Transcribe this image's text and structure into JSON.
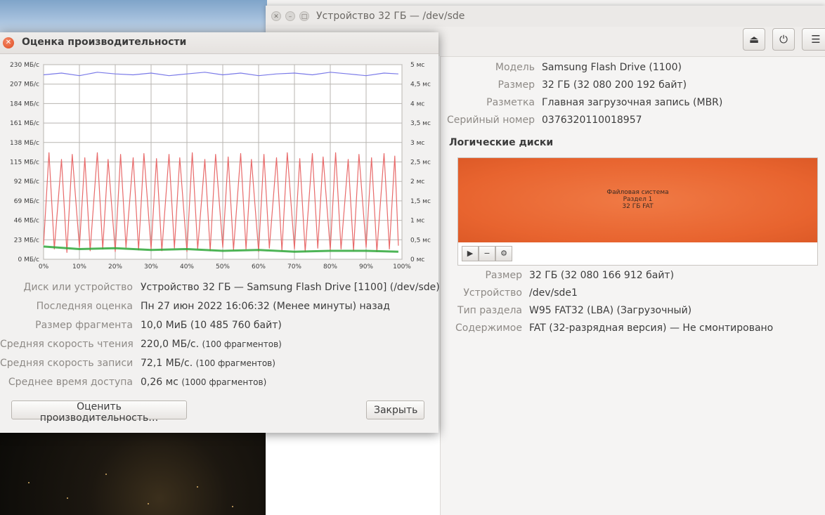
{
  "desktop": {
    "top_text": ""
  },
  "disks_window": {
    "title": "Устройство 32 ГБ — /dev/sde",
    "toolbar": {
      "eject_icon": "eject-icon",
      "power_icon": "power-icon",
      "menu_icon": "menu-icon"
    },
    "drive": {
      "model_label": "Модель",
      "model_value": "Samsung Flash Drive (1100)",
      "size_label": "Размер",
      "size_value": "32 ГБ (32 080 200 192 байт)",
      "partitioning_label": "Разметка",
      "partitioning_value": "Главная загрузочная запись (MBR)",
      "serial_label": "Серийный номер",
      "serial_value": "0376320110018957"
    },
    "volumes_heading": "Логические диски",
    "partition": {
      "line1": "Файловая система",
      "line2": "Раздел 1",
      "line3": "32 ГБ FAT"
    },
    "volume": {
      "size_label": "Размер",
      "size_value": "32 ГБ (32 080 166 912 байт)",
      "device_label": "Устройство",
      "device_value": "/dev/sde1",
      "type_label": "Тип раздела",
      "type_value": "W95 FAT32 (LBA) (Загрузочный)",
      "contents_label": "Содержимое",
      "contents_value": "FAT (32-разрядная версия) — Не смонтировано"
    },
    "colors": {
      "partition": "#e8642f"
    }
  },
  "benchmark_dialog": {
    "title": "Оценка производительности",
    "stats": {
      "device_label": "Диск или устройство",
      "device_value": "Устройство 32 ГБ — Samsung Flash Drive [1100] (/dev/sde)",
      "last_label": "Последняя оценка",
      "last_value": "Пн 27 июн 2022 16:06:32 (Менее минуты) назад",
      "sample_label": "Размер фрагмента",
      "sample_value": "10,0 МиБ (10 485 760 байт)",
      "read_label": "Средняя скорость чтения",
      "read_value": "220,0 МБ/с.",
      "read_note": "(100 фрагментов)",
      "write_label": "Средняя скорость записи",
      "write_value": "72,1 МБ/с.",
      "write_note": "(100 фрагментов)",
      "access_label": "Среднее время доступа",
      "access_value": "0,26 мс",
      "access_note": "(1000 фрагментов)"
    },
    "buttons": {
      "benchmark": "Оценить производительность…",
      "close": "Закрыть"
    }
  },
  "chart_data": {
    "type": "line",
    "title": "",
    "xlabel": "",
    "ylabel": "",
    "x_ticks": [
      "0%",
      "10%",
      "20%",
      "30%",
      "40%",
      "50%",
      "60%",
      "70%",
      "80%",
      "90%",
      "100%"
    ],
    "y_left_ticks": [
      "0 МБ/с",
      "23 МБ/с",
      "46 МБ/с",
      "69 МБ/с",
      "92 МБ/с",
      "115 МБ/с",
      "138 МБ/с",
      "161 МБ/с",
      "184 МБ/с",
      "207 МБ/с",
      "230 МБ/с"
    ],
    "y_right_ticks": [
      "0 мс",
      "0,5 мс",
      "1 мс",
      "1,5 мс",
      "2 мс",
      "2,5 мс",
      "3 мс",
      "3,5 мс",
      "4 мс",
      "4,5 мс",
      "5 мс"
    ],
    "xlim": [
      0,
      100
    ],
    "ylim_left": [
      0,
      230
    ],
    "ylim_right": [
      0,
      5
    ],
    "grid": true,
    "series": [
      {
        "axis": "left",
        "color": "#7a7ae8",
        "x": [
          0,
          5,
          10,
          15,
          20,
          25,
          30,
          35,
          40,
          45,
          50,
          55,
          60,
          65,
          70,
          75,
          80,
          85,
          90,
          95,
          99
        ],
        "values": [
          218,
          220,
          217,
          221,
          219,
          218,
          220,
          217,
          219,
          221,
          218,
          220,
          217,
          219,
          220,
          218,
          221,
          219,
          217,
          220,
          219
        ]
      },
      {
        "axis": "left",
        "color": "#e86a6a",
        "style": "zigzag",
        "x": [
          0,
          1.5,
          3,
          5,
          6.5,
          8,
          10,
          11.5,
          13,
          15,
          16.5,
          18,
          20,
          21.5,
          23,
          25,
          26.5,
          28,
          30,
          31.5,
          33,
          35,
          36.5,
          38,
          40,
          41.5,
          43,
          45,
          46.5,
          48,
          50,
          51.5,
          53,
          55,
          56.5,
          58,
          60,
          61.5,
          63,
          65,
          66.5,
          68,
          70,
          71.5,
          73,
          75,
          76.5,
          78,
          80,
          81.5,
          83,
          85,
          86.5,
          88,
          90,
          91.5,
          93,
          95,
          96.5,
          98,
          99
        ],
        "values": [
          17,
          126,
          12,
          118,
          8,
          124,
          14,
          120,
          10,
          126,
          12,
          118,
          9,
          124,
          14,
          120,
          11,
          125,
          12,
          119,
          10,
          124,
          13,
          120,
          9,
          126,
          12,
          118,
          10,
          124,
          14,
          121,
          11,
          125,
          12,
          118,
          9,
          124,
          13,
          120,
          10,
          126,
          12,
          119,
          9,
          125,
          13,
          121,
          11,
          126,
          12,
          118,
          10,
          124,
          14,
          120,
          9,
          125,
          12,
          122,
          16
        ]
      },
      {
        "axis": "left",
        "color": "#2fa83a",
        "x": [
          0,
          10,
          20,
          30,
          40,
          50,
          60,
          70,
          80,
          90,
          99
        ],
        "values": [
          15,
          12,
          13,
          11,
          12,
          10,
          11,
          9,
          10,
          10,
          9
        ]
      }
    ]
  }
}
